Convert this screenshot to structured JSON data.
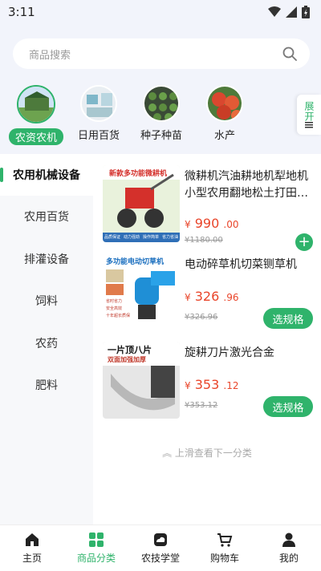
{
  "status_bar": {
    "time": "3:11"
  },
  "search": {
    "placeholder": "商品搜索"
  },
  "categories": [
    {
      "label": "农资农机",
      "active": true
    },
    {
      "label": "日用百货",
      "active": false
    },
    {
      "label": "种子种苗",
      "active": false
    },
    {
      "label": "水产",
      "active": false
    }
  ],
  "expand": {
    "label": "展开"
  },
  "sidebar": {
    "items": [
      {
        "label": "农用机械设备",
        "active": true
      },
      {
        "label": "农用百货",
        "active": false
      },
      {
        "label": "排灌设备",
        "active": false
      },
      {
        "label": "饲料",
        "active": false
      },
      {
        "label": "农药",
        "active": false
      },
      {
        "label": "肥料",
        "active": false
      }
    ]
  },
  "products": [
    {
      "title": "微耕机汽油耕地机犁地机小型农用翻地松土打田…",
      "price_symbol": "¥",
      "price_int": "990",
      "price_dec": ".00",
      "original_price": "¥1180.00",
      "action": "+",
      "thumb_text": "新款多功能微耕机",
      "thumb_tags": [
        "品质保证",
        "动力强劲",
        "操作简单",
        "省力省油"
      ]
    },
    {
      "title": "电动碎草机切菜铡草机",
      "price_symbol": "¥",
      "price_int": "326",
      "price_dec": ".96",
      "original_price": "¥326.96",
      "action": "选规格",
      "thumb_text": "多功能电动切草机",
      "thumb_tags": [
        "省时省力",
        "安全高效",
        "十年超长质保"
      ]
    },
    {
      "title": "旋耕刀片激光合金",
      "price_symbol": "¥",
      "price_int": "353",
      "price_dec": ".12",
      "original_price": "¥353.12",
      "action": "选规格",
      "thumb_text": "一片顶八片",
      "thumb_sub": "双面加强加厚"
    }
  ],
  "scroll_hint": "上滑查看下一分类",
  "tabbar": [
    {
      "label": "主页",
      "icon": "home-icon",
      "active": false
    },
    {
      "label": "商品分类",
      "icon": "grid-icon",
      "active": true
    },
    {
      "label": "农技学堂",
      "icon": "cloud-icon",
      "active": false
    },
    {
      "label": "购物车",
      "icon": "cart-icon",
      "active": false
    },
    {
      "label": "我的",
      "icon": "user-icon",
      "active": false
    }
  ],
  "colors": {
    "accent": "#2fb36b",
    "price": "#e9452a",
    "page_bg": "#f2f4fb"
  }
}
